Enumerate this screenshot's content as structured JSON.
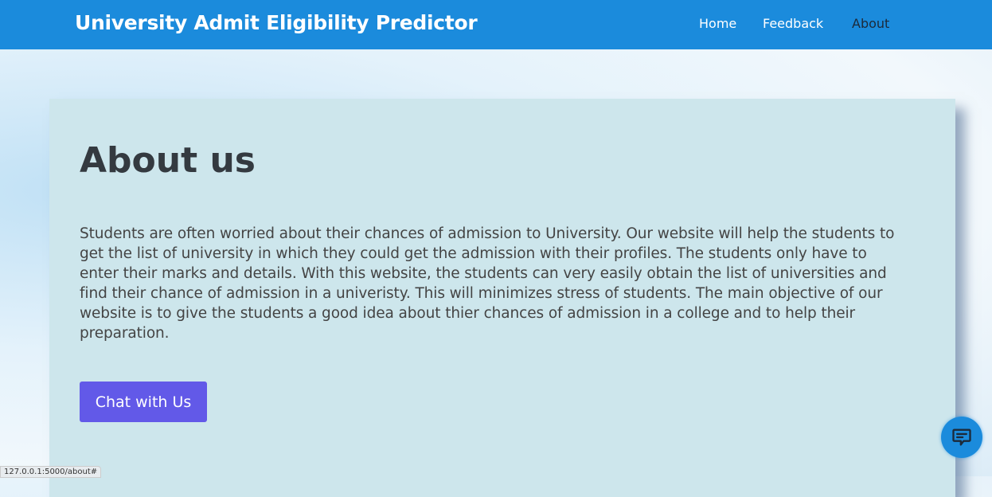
{
  "navbar": {
    "brand": "University Admit Eligibility Predictor",
    "links": [
      "Home",
      "Feedback",
      "About"
    ],
    "active": "About"
  },
  "main": {
    "heading": "About us",
    "paragraph": "Students are often worried about their chances of admission to University. Our website will help the students to get the list of university in which they could get the admission with their profiles. The students only have to enter their marks and details. With this website, the students can very easily obtain the list of universities and find their chance of admission in a univeristy. This will minimizes stress of students. The main objective of our website is to give the students a good idea about thier chances of admission in a college and to help their preparation.",
    "chat_button": "Chat with Us"
  },
  "chat_widget": {
    "icon": "chat-icon"
  },
  "status_bar": {
    "url": "127.0.0.1:5000/about#"
  },
  "colors": {
    "navbar": "#1b8bdc",
    "button": "#6259e8",
    "card": "#cde6ec"
  }
}
